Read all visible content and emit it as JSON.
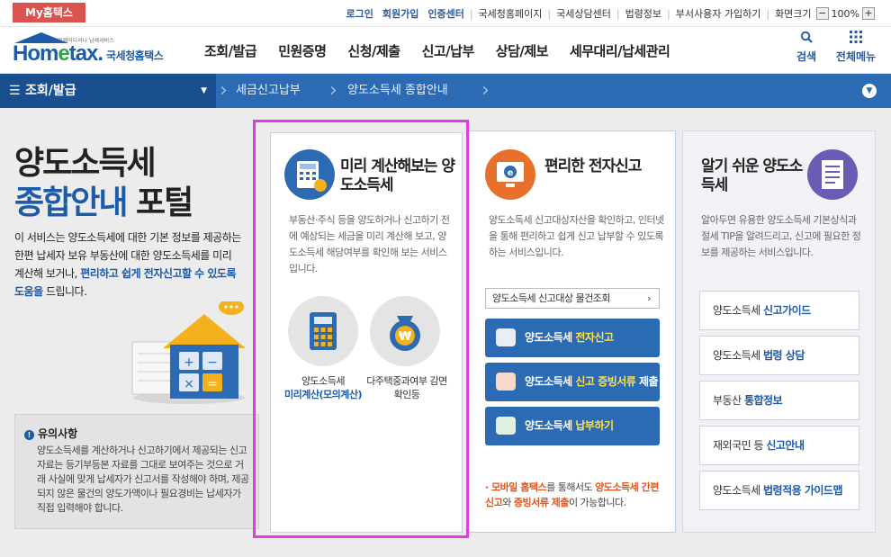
{
  "util": {
    "my_hometax": "My홈택스",
    "links": [
      "로그인",
      "회원가입",
      "인증센터",
      "국세청홈페이지",
      "국세상담센터",
      "법령정보",
      "부서사용자 가입하기",
      "화면크기"
    ],
    "zoom_minus": "−",
    "zoom_level": "100%",
    "zoom_plus": "+"
  },
  "header": {
    "logo_text_a": "Hom",
    "logo_text_e": "e",
    "logo_text_b": "tax.",
    "logo_org": "국세청홈택스",
    "logo_small": "언제어디서나 납세서비스",
    "nav": [
      "조회/발급",
      "민원증명",
      "신청/제출",
      "신고/납부",
      "상담/제보",
      "세무대리/납세관리"
    ],
    "search_label": "검색",
    "allmenu_label": "전체메뉴",
    "colors": {
      "brand": "#1d5aa8",
      "accent_green": "#2aa64c"
    }
  },
  "breadcrumb": {
    "menu": "조회/발급",
    "item1": "세금신고납부",
    "item2": "양도소득세 종합안내"
  },
  "main": {
    "title_line1": "양도소득세",
    "title_line2_blue": "종합안내",
    "title_line2_black": " 포털",
    "intro_plain": "이 서비스는 양도소득세에 대한 기본 정보를 제공하는 한편 납세자 보유 부동산에 대한 양도소득세를 미리 계산해 보거나, ",
    "intro_highlight": "편리하고 쉽게 전자신고할 수 있도록 도움을",
    "intro_tail": " 드립니다.",
    "notice_title": "유의사항",
    "notice_text": "양도소득세를 계산하거나 신고하기에서 제공되는 신고 자료는 등기부등본 자료를 그대로 보여주는 것으로 거래 사실에 맞게 납세자가 신고서를 작성해야 하며, 제공되지 않은 물건의 양도가액이나 필요경비는 납세자가 직접 입력해야 합니다."
  },
  "card1": {
    "title": "미리 계산해보는 양도소득세",
    "desc": "부동산·주식 등을 양도하거나 신고하기 전에 예상되는 세금을 미리 계산해 보고, 양도소득세 해당여부를 확인해 보는 서비스입니다.",
    "item1_label": "양도소득세",
    "item1_link": "미리계산(모의계산)",
    "item2_label": "다주택중과여부 감면확인등"
  },
  "card2": {
    "title": "편리한 전자신고",
    "desc": "양도소득세 신고대상자산을 확인하고, 인터넷을 통해 편리하고 쉽게 신고 납부할 수 있도록 하는 서비스입니다.",
    "lookup": "양도소득세 신고대상 물건조회",
    "btn1_a": "양도소득세 ",
    "btn1_b": "전자신고",
    "btn2_a": "양도소득세 ",
    "btn2_b": "신고 증빙서류",
    "btn2_c": " 제출",
    "btn3_a": "양도소득세 ",
    "btn3_b": "납부하기",
    "mobile_a": "모바일 홈택스",
    "mobile_b": "를 통해서도 ",
    "mobile_c": "양도소득세 간편신고",
    "mobile_d": "와 ",
    "mobile_e": "증빙서류 제출",
    "mobile_f": "이 가능합니다."
  },
  "card3": {
    "title": "알기 쉬운 양도소득세",
    "desc": "알아두면 유용한 양도소득세 기본상식과 절세 TIP을 알려드리고, 신고에 필요한 정보를 제공하는 서비스입니다.",
    "items": [
      {
        "plain": "양도소득세 ",
        "bold": "신고가이드"
      },
      {
        "plain": "양도소득세 ",
        "bold": "법령 상담"
      },
      {
        "plain": "부동산 ",
        "bold": "통합정보"
      },
      {
        "plain": "재외국민 등 ",
        "bold": "신고안내"
      },
      {
        "plain": "양도소득세 ",
        "bold": "법령적용 가이드맵"
      }
    ]
  }
}
